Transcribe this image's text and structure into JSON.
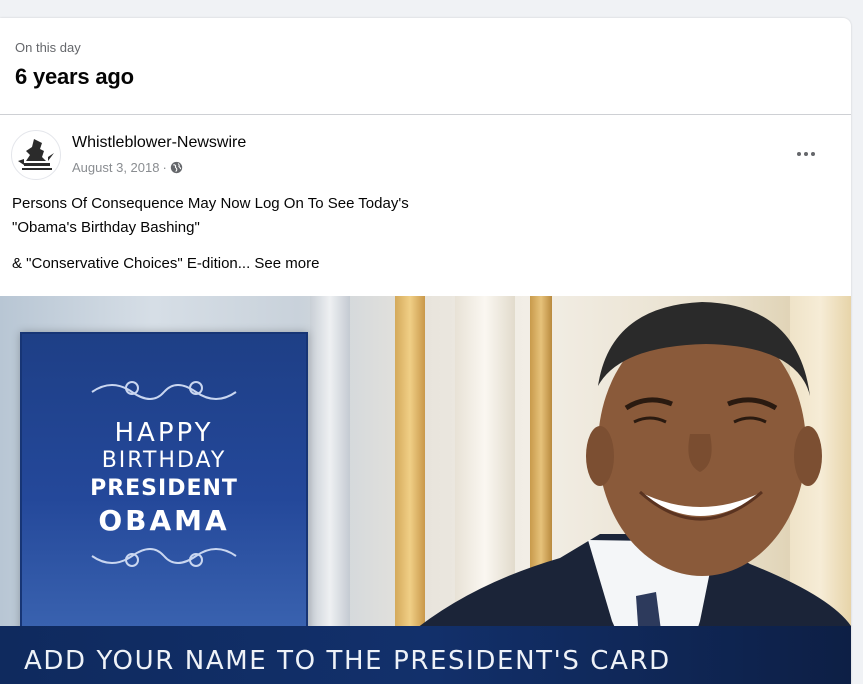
{
  "memory": {
    "caption": "On this day",
    "title": "6 years ago"
  },
  "post": {
    "author": "Whistleblower-Newswire",
    "date": "August 3, 2018",
    "separator": "·",
    "privacy_icon": "globe-icon",
    "text_line1": "Persons Of Consequence May Now Log On To See Today's",
    "text_line2": "\"Obama's Birthday Bashing\"",
    "text_line3": "& \"Conservative Choices\" E-dition...",
    "see_more": "See more",
    "more_icon": "more-options-icon"
  },
  "image": {
    "card_line1": "HAPPY",
    "card_line2": "BIRTHDAY",
    "card_line3": "PRESIDENT",
    "card_line4": "OBAMA",
    "banner": "ADD YOUR NAME TO THE PRESIDENT'S CARD"
  },
  "colors": {
    "card_blue": "#24489a",
    "banner_navy": "#12306b",
    "text_primary": "#050505",
    "text_secondary": "#65676b"
  }
}
